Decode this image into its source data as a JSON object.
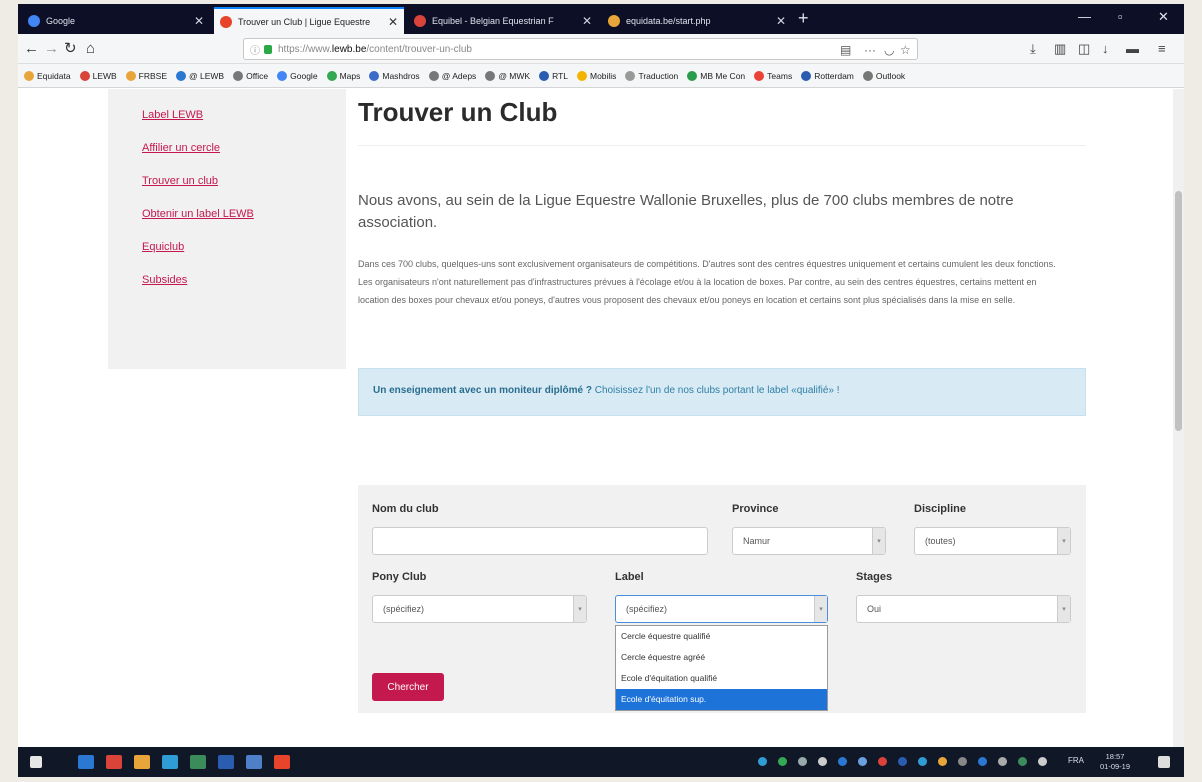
{
  "browser": {
    "tabs": [
      {
        "label": "Google",
        "active": false,
        "color": "#4285f4"
      },
      {
        "label": "Trouver un Club | Ligue Equestre",
        "active": true,
        "color": "#e8432b"
      },
      {
        "label": "Equibel - Belgian Equestrian F",
        "active": false,
        "color": "#d9433a"
      },
      {
        "label": "equidata.be/start.php",
        "active": false,
        "color": "#e8a53a"
      }
    ],
    "new_tab": "+",
    "url": {
      "prefix": "https://www.",
      "domain": "lewb.be",
      "path": "/content/trouver-un-club"
    },
    "bookmarks": [
      {
        "label": "Equidata",
        "color": "#e8a53a"
      },
      {
        "label": "LEWB",
        "color": "#d9433a"
      },
      {
        "label": "FRBSE",
        "color": "#e8a53a"
      },
      {
        "label": "@ LEWB",
        "color": "#2a78d2"
      },
      {
        "label": "Office",
        "color": "#777777"
      },
      {
        "label": "Google",
        "color": "#4285f4"
      },
      {
        "label": "Maps",
        "color": "#34a853"
      },
      {
        "label": "Mashdros",
        "color": "#3b6bc9"
      },
      {
        "label": "@ Adeps",
        "color": "#777777"
      },
      {
        "label": "@ MWK",
        "color": "#777777"
      },
      {
        "label": "RTL",
        "color": "#2a5db0"
      },
      {
        "label": "Mobilis",
        "color": "#f2b400"
      },
      {
        "label": "Traduction",
        "color": "#999999"
      },
      {
        "label": "MB Me Con",
        "color": "#2a9d4a"
      },
      {
        "label": "Teams",
        "color": "#ea4335"
      },
      {
        "label": "Rotterdam",
        "color": "#2a5db0"
      },
      {
        "label": "Outlook",
        "color": "#777777"
      }
    ]
  },
  "sidebar": {
    "links": [
      "Label LEWB",
      "Affilier un cercle",
      "Trouver un club",
      "Obtenir un label LEWB",
      "Equiclub",
      "Subsides"
    ]
  },
  "main": {
    "title": "Trouver un Club",
    "lead": "Nous avons, au sein de la Ligue Equestre Wallonie Bruxelles, plus de 700 clubs membres de notre association.",
    "body": "Dans ces 700 clubs, quelques-uns sont exclusivement organisateurs de compétitions. D'autres sont des centres équestres uniquement et certains cumulent les deux fonctions. Les organisateurs n'ont naturellement pas d'infrastructures prévues à l'écolage et/ou à la location de boxes. Par contre, au sein des centres équestres, certains mettent en location des boxes pour chevaux et/ou poneys, d'autres vous proposent des chevaux et/ou poneys en location et certains sont plus spécialisés dans la mise en selle.",
    "alert": {
      "bold": "Un enseignement avec un moniteur diplômé ?",
      "text": " Choisissez l'un de nos clubs portant le label «qualifié» !"
    }
  },
  "form": {
    "club_name_label": "Nom du club",
    "club_name_value": "",
    "province_label": "Province",
    "province_value": "Namur",
    "discipline_label": "Discipline",
    "discipline_value": "(toutes)",
    "ponyclub_label": "Pony Club",
    "ponyclub_value": "(spécifiez)",
    "label_label": "Label",
    "label_value": "(spécifiez)",
    "stages_label": "Stages",
    "stages_value": "Oui",
    "label_options": [
      "Cercle équestre qualifié",
      "Cercle équestre agréé",
      "Ecole d'équitation qualifié",
      "Ecole d'équitation sup."
    ],
    "highlighted_option": 3,
    "search_button": "Chercher"
  },
  "taskbar": {
    "lang": "FRA",
    "time": "18:57",
    "date": "01-09-19"
  }
}
